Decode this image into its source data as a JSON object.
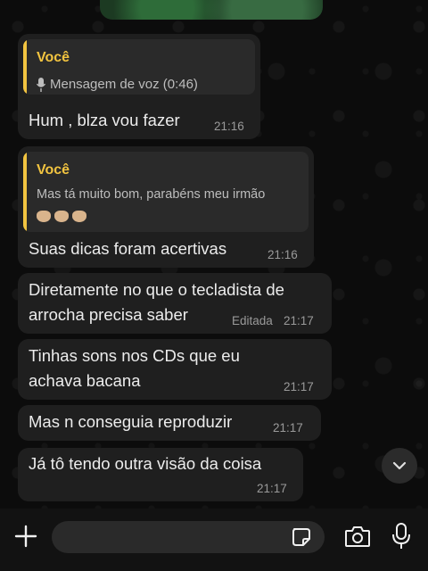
{
  "messages": [
    {
      "quote": {
        "author": "Você",
        "text": "Mensagem de voz (0:46)",
        "icon": "microphone-icon"
      },
      "text": "Hum , blza vou fazer",
      "time": "21:16"
    },
    {
      "quote": {
        "author": "Você",
        "text": "Mas tá muito bom, parabéns meu irmão",
        "emojis": "clapping-hands x3"
      },
      "text": "Suas dicas foram acertivas",
      "time": "21:16"
    },
    {
      "lines": [
        "Diretamente no que o tecladista de",
        "arrocha precisa saber"
      ],
      "edited": "Editada",
      "time": "21:17"
    },
    {
      "lines": [
        "Tinhas sons nos CDs que eu",
        "achava bacana"
      ],
      "time": "21:17"
    },
    {
      "text": "Mas n conseguia reproduzir",
      "time": "21:17"
    },
    {
      "text": "Já tô tendo outra visão da coisa",
      "time": "21:17"
    }
  ],
  "composer": {
    "placeholder": "",
    "icons": [
      "plus-icon",
      "sticker-icon",
      "camera-icon",
      "microphone-icon"
    ]
  },
  "colors": {
    "bubble": "#1f1f1f",
    "quote_accent": "#f2c440",
    "background": "#0b0b0b"
  }
}
